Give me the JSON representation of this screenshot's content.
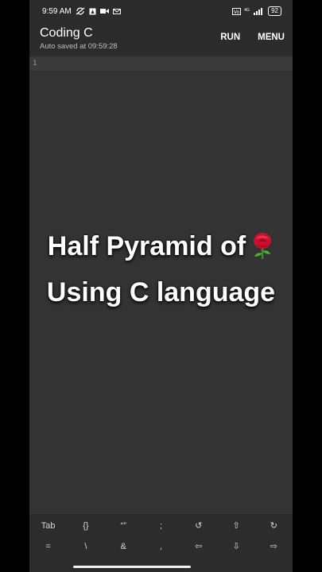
{
  "status": {
    "time": "9:59 AM",
    "battery": "92",
    "icons_left": [
      "sync-off-icon",
      "alert-icon",
      "video-icon",
      "mail-icon"
    ],
    "icons_right": [
      "volte-icon",
      "4g-icon",
      "signal-icon",
      "battery-icon"
    ]
  },
  "app": {
    "title": "Coding C",
    "subtitle": "Auto saved at 09:59:28",
    "run_label": "RUN",
    "menu_label": "MENU"
  },
  "editor": {
    "line_number": "1"
  },
  "overlay": {
    "line1": "Half Pyramid of",
    "line2": "Using C language",
    "emoji_icon": "rose-icon"
  },
  "keys": {
    "row1": [
      "Tab",
      "{}",
      "“”",
      ";",
      "↺",
      "⇧",
      "↻"
    ],
    "row2": [
      "=",
      "\\",
      "&",
      ",",
      "⇦",
      "⇩",
      "⇨"
    ]
  },
  "colors": {
    "background": "#333333",
    "appbar": "#2b2b2b",
    "keybar": "#2c2c2c"
  }
}
